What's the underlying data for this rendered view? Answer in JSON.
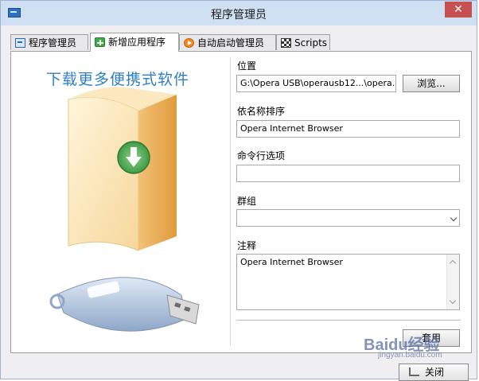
{
  "window": {
    "title": "程序管理员"
  },
  "tabs": [
    {
      "label": "程序管理员",
      "icon": "manager-icon"
    },
    {
      "label": "新增应用程序",
      "icon": "add-app-icon",
      "active": true
    },
    {
      "label": "自动启动管理员",
      "icon": "autostart-icon"
    },
    {
      "label": "Scripts",
      "icon": "scripts-icon"
    }
  ],
  "promo": {
    "text": "下载更多便携式软件"
  },
  "form": {
    "location": {
      "label": "位置",
      "value": "G:\\Opera USB\\operausb12...\\opera.exe",
      "browse_label": "浏览..."
    },
    "sort_name": {
      "label": "依名称排序",
      "value": "Opera Internet Browser"
    },
    "cmdline": {
      "label": "命令行选项",
      "value": ""
    },
    "group": {
      "label": "群组",
      "value": ""
    },
    "notes": {
      "label": "注释",
      "value": "Opera Internet Browser"
    },
    "apply_label": "套用"
  },
  "footer": {
    "close_label": "关闭"
  },
  "watermark": {
    "text": "Baidu经验",
    "sub": "jingyan.baidu.com"
  },
  "colors": {
    "accent": "#2f7fc7",
    "titlebar": "#cfe0f3",
    "close": "#c75050"
  }
}
